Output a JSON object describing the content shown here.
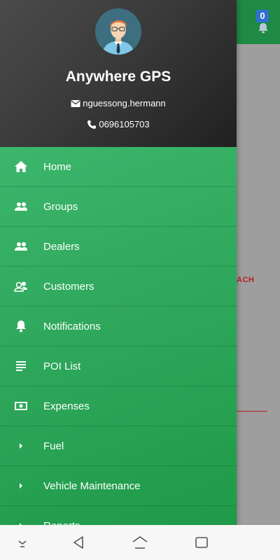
{
  "background_app": {
    "notification_count": "0",
    "partial_text": "ACH"
  },
  "drawer": {
    "app_name": "Anywhere GPS",
    "email": "nguessong.hermann",
    "phone": "0696105703",
    "menu": [
      {
        "label": "Home",
        "icon": "home-icon"
      },
      {
        "label": "Groups",
        "icon": "people-icon"
      },
      {
        "label": "Dealers",
        "icon": "people-icon"
      },
      {
        "label": "Customers",
        "icon": "supervisor-icon"
      },
      {
        "label": "Notifications",
        "icon": "bell-icon"
      },
      {
        "label": "POI List",
        "icon": "list-icon"
      },
      {
        "label": "Expenses",
        "icon": "money-icon"
      },
      {
        "label": "Fuel",
        "icon": "chevron-right-icon"
      },
      {
        "label": "Vehicle Maintenance",
        "icon": "chevron-right-icon"
      },
      {
        "label": "Reports",
        "icon": "chevron-right-icon"
      }
    ]
  },
  "colors": {
    "menu_green": "#2fa85c",
    "header_dark": "#3a3a3a",
    "topbar_green": "#1e8a44",
    "badge_blue": "#2f6fd0",
    "accent_red": "#b32020"
  }
}
